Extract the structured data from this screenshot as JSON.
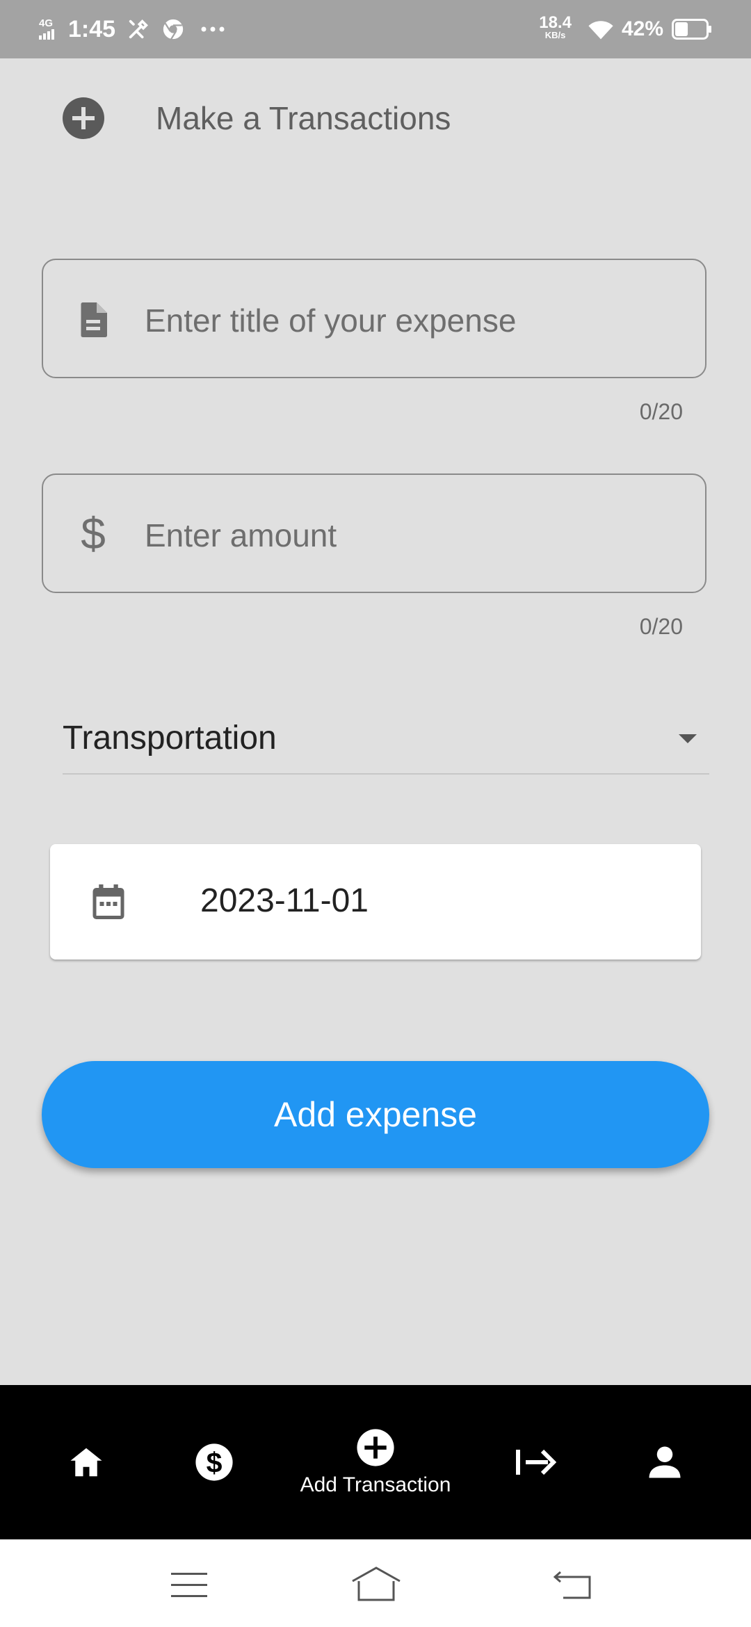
{
  "status_bar": {
    "network": "4G",
    "time": "1:45",
    "speed_value": "18.4",
    "speed_unit": "KB/s",
    "battery": "42%",
    "battery_level": 0.42,
    "icons": [
      "signal-icon",
      "tools-icon",
      "chrome-icon",
      "more-icon",
      "wifi-icon",
      "battery-icon"
    ]
  },
  "header": {
    "title": "Make a Transactions",
    "icon": "add-circle-icon"
  },
  "form": {
    "title_field": {
      "placeholder": "Enter title of your expense",
      "value": "",
      "counter": "0/20",
      "icon": "document-icon"
    },
    "amount_field": {
      "placeholder": "Enter amount",
      "value": "",
      "counter": "0/20",
      "icon": "dollar-icon"
    },
    "category": {
      "selected": "Transportation",
      "icon": "dropdown-caret-icon"
    },
    "date": {
      "value": "2023-11-01",
      "icon": "calendar-icon"
    },
    "submit_label": "Add expense"
  },
  "bottom_nav": {
    "items": [
      {
        "icon": "home-icon",
        "label": ""
      },
      {
        "icon": "dollar-circle-icon",
        "label": ""
      },
      {
        "icon": "add-circle-icon",
        "label": "Add Transaction",
        "active": true
      },
      {
        "icon": "logout-icon",
        "label": ""
      },
      {
        "icon": "person-icon",
        "label": ""
      }
    ]
  },
  "system_nav": {
    "icons": [
      "menu-icon",
      "home-outline-icon",
      "back-icon"
    ]
  },
  "colors": {
    "background": "#e0e0e0",
    "status_bar": "#a3a3a3",
    "accent": "#2196f3",
    "nav_bar": "#000000",
    "date_card": "#ffffff"
  }
}
